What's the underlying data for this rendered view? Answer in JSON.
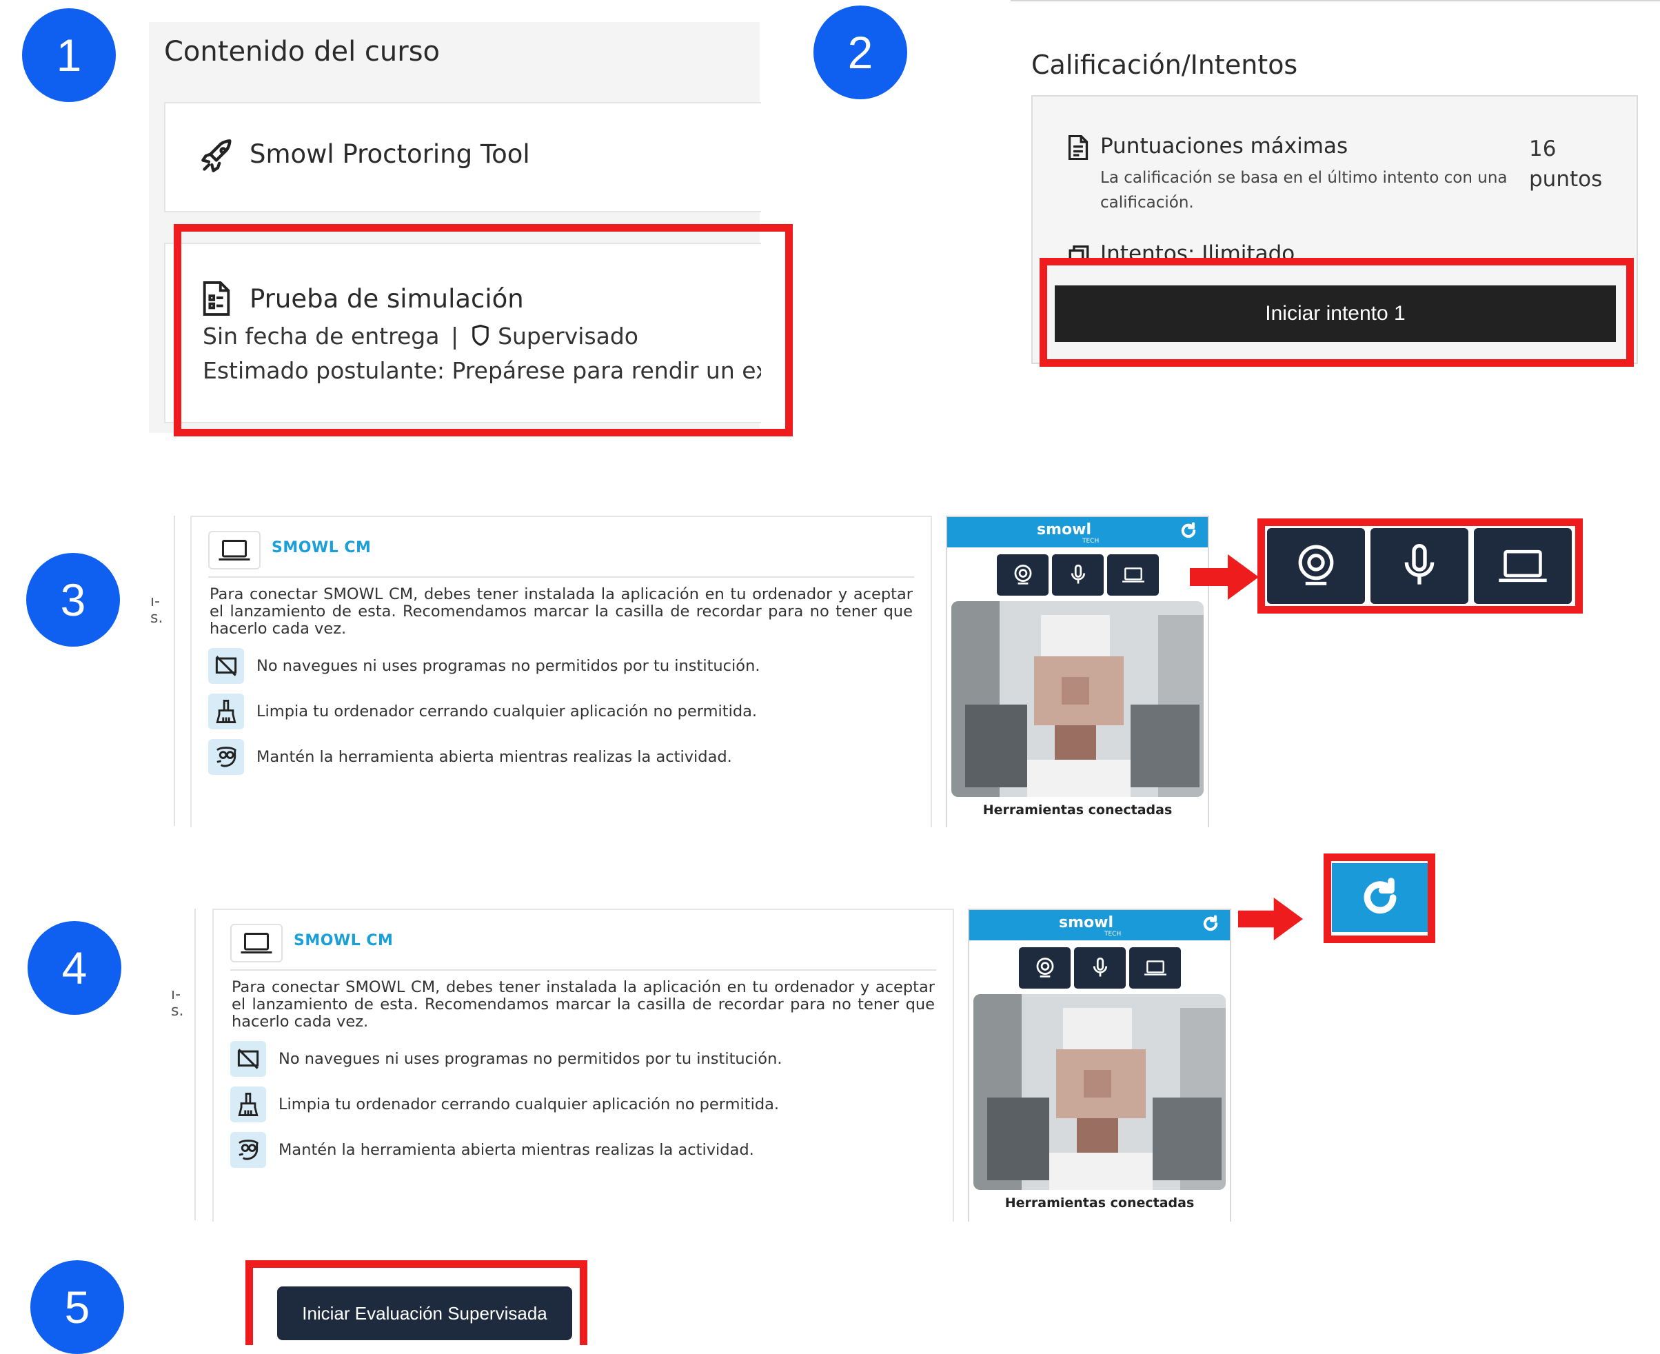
{
  "steps": [
    "1",
    "2",
    "3",
    "4",
    "5"
  ],
  "panel1": {
    "section_title": "Contenido del curso",
    "tool_name": "Smowl Proctoring Tool",
    "quiz_title": "Prueba de simulación",
    "quiz_meta_due": "Sin fecha de entrega",
    "quiz_meta_separator": "|",
    "quiz_meta_supervised": "Supervisado",
    "quiz_description": "Estimado postulante: Prepárese para rendir un examen d"
  },
  "panel2": {
    "section_title": "Calificación/Intentos",
    "max_scores_title": "Puntuaciones máximas",
    "max_scores_desc": "La calificación se basa en el último intento con una calificación.",
    "points": "16 puntos",
    "attempts_label": "Intentos: Ilimitado",
    "start_button": "Iniciar intento 1"
  },
  "smowl_card": {
    "title": "SMOWL CM",
    "instructions": "Para conectar SMOWL CM, debes tener instalada la aplicación en tu ordenador y aceptar el lanzamiento de esta. Recomendamos marcar la casilla de recordar para no tener que hacerlo cada vez.",
    "rules": [
      "No navegues ni uses programas no permitidos por tu institución.",
      "Limpia tu ordenador cerrando cualquier aplicación no permitida.",
      "Mantén la herramienta abierta mientras realizas la actividad."
    ],
    "left_stub_lines": [
      "ı-",
      "s."
    ]
  },
  "widget": {
    "logo": "smowl",
    "logo_sub": "TECH",
    "caption": "Herramientas conectadas"
  },
  "panel5": {
    "button": "Iniciar Evaluación Supervisada"
  },
  "colors": {
    "step_circle": "#0f5ff0",
    "highlight": "#ee1c1c",
    "smowl_blue": "#1a9ad9",
    "dark_navy": "#1e2b3f"
  }
}
